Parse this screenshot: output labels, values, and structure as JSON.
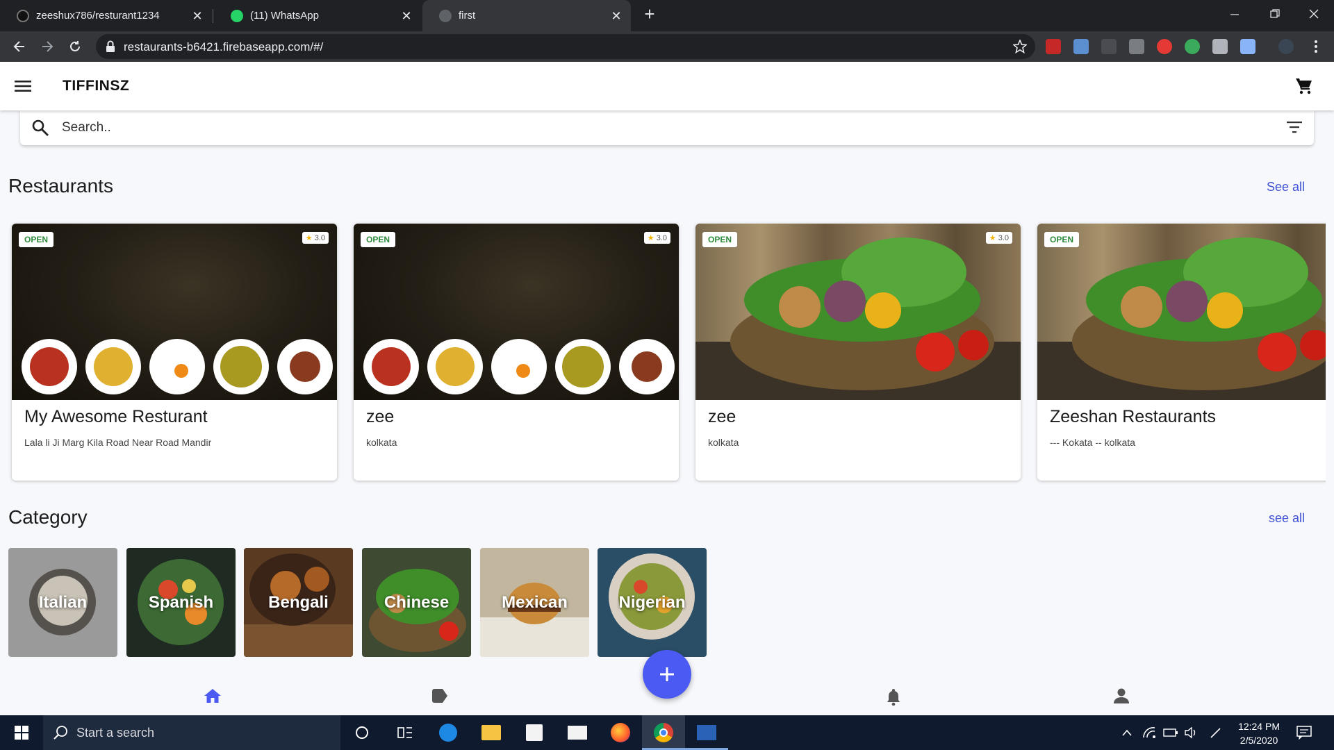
{
  "browser": {
    "tabs": [
      {
        "title": "zeeshux786/resturant1234",
        "favicon": "github-icon"
      },
      {
        "title": "(11) WhatsApp",
        "favicon": "whatsapp-icon"
      },
      {
        "title": "first",
        "favicon": "globe-icon"
      }
    ],
    "url": "restaurants-b6421.firebaseapp.com/#/"
  },
  "app": {
    "brand": "TIFFINSZ",
    "search_placeholder": "Search..",
    "restaurants_title": "Restaurants",
    "restaurants_see_all": "See all",
    "category_title": "Category",
    "category_see_all": "see all",
    "restaurants": [
      {
        "name": "My Awesome Resturant",
        "address": "Lala li Ji Marg Kila Road Near Road Mandir",
        "status": "OPEN",
        "rating": "3.0",
        "image": "dark-plates"
      },
      {
        "name": "zee",
        "address": "kolkata",
        "status": "OPEN",
        "rating": "3.0",
        "image": "dark-plates"
      },
      {
        "name": "zee",
        "address": "kolkata",
        "status": "OPEN",
        "rating": "3.0",
        "image": "veg-basket"
      },
      {
        "name": "Zeeshan Restaurants",
        "address": "--- Kokata -- kolkata",
        "status": "OPEN",
        "rating": "",
        "image": "veg-basket"
      }
    ],
    "categories": [
      {
        "label": "Italian",
        "color": "#8e8e8e"
      },
      {
        "label": "Spanish",
        "color": "#2b4a2a"
      },
      {
        "label": "Bengali",
        "color": "#6b4024"
      },
      {
        "label": "Chinese",
        "color": "#4c5a3a"
      },
      {
        "label": "Mexican",
        "color": "#b7a888"
      },
      {
        "label": "Nigerian",
        "color": "#3c5a6a"
      }
    ],
    "bottom_nav": [
      "home-icon",
      "tag-icon",
      "bell-icon",
      "person-icon"
    ],
    "accent_color": "#4a5af2"
  },
  "taskbar": {
    "search_text": "Start a search",
    "time": "12:24 PM",
    "date": "2/5/2020"
  }
}
